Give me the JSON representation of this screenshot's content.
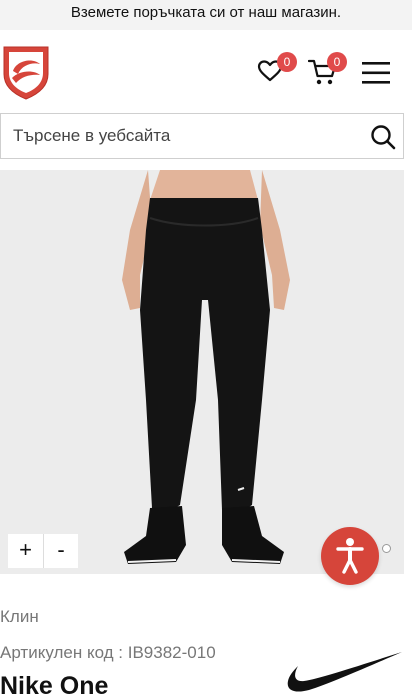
{
  "promo": {
    "text": "Вземете поръчката си от наш магазин."
  },
  "header": {
    "wishlist_count": "0",
    "cart_count": "0",
    "brand_color": "#d6453a",
    "badge_color": "#e04a4a",
    "icons": [
      "heart-icon",
      "cart-icon",
      "hamburger-menu-icon"
    ]
  },
  "search": {
    "placeholder": "Търсене в уебсайта",
    "value": ""
  },
  "gallery": {
    "zoom_in": "+",
    "zoom_out": "-"
  },
  "product": {
    "category": "Клин",
    "sku_label": "Артикулен код : IB9382-010",
    "title": "Nike One"
  }
}
